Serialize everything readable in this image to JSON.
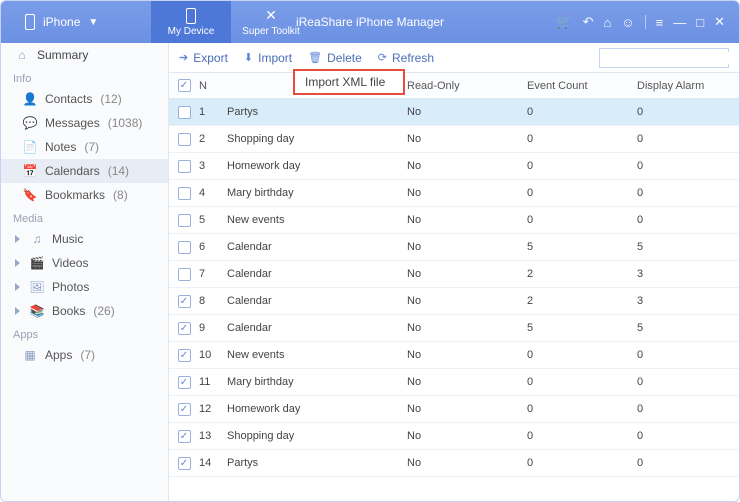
{
  "titlebar": {
    "device_label": "iPhone",
    "title": "iReaShare iPhone Manager"
  },
  "tabs": {
    "my_device": "My Device",
    "super_toolkit": "Super Toolkit"
  },
  "sidebar": {
    "summary": "Summary",
    "heads": {
      "info": "Info",
      "media": "Media",
      "apps": "Apps"
    },
    "info": [
      {
        "label": "Contacts",
        "count": "(12)"
      },
      {
        "label": "Messages",
        "count": "(1038)"
      },
      {
        "label": "Notes",
        "count": "(7)"
      },
      {
        "label": "Calendars",
        "count": "(14)"
      },
      {
        "label": "Bookmarks",
        "count": "(8)"
      }
    ],
    "media": [
      {
        "label": "Music",
        "count": ""
      },
      {
        "label": "Videos",
        "count": ""
      },
      {
        "label": "Photos",
        "count": ""
      },
      {
        "label": "Books",
        "count": "(26)"
      }
    ],
    "apps": [
      {
        "label": "Apps",
        "count": "(7)"
      }
    ]
  },
  "toolbar": {
    "export": "Export",
    "import": "Import",
    "delete": "Delete",
    "refresh": "Refresh",
    "dropdown_item": "Import XML file"
  },
  "columns": {
    "name": "N",
    "readonly": "Read-Only",
    "eventcount": "Event Count",
    "displayalarm": "Display Alarm"
  },
  "rows": [
    {
      "chk": false,
      "idx": "1",
      "name": "Partys",
      "ro": "No",
      "ec": "0",
      "da": "0",
      "sel": true
    },
    {
      "chk": false,
      "idx": "2",
      "name": "Shopping day",
      "ro": "No",
      "ec": "0",
      "da": "0"
    },
    {
      "chk": false,
      "idx": "3",
      "name": "Homework day",
      "ro": "No",
      "ec": "0",
      "da": "0"
    },
    {
      "chk": false,
      "idx": "4",
      "name": "Mary birthday",
      "ro": "No",
      "ec": "0",
      "da": "0"
    },
    {
      "chk": false,
      "idx": "5",
      "name": "New events",
      "ro": "No",
      "ec": "0",
      "da": "0"
    },
    {
      "chk": false,
      "idx": "6",
      "name": "Calendar",
      "ro": "No",
      "ec": "5",
      "da": "5"
    },
    {
      "chk": false,
      "idx": "7",
      "name": "Calendar",
      "ro": "No",
      "ec": "2",
      "da": "3"
    },
    {
      "chk": true,
      "idx": "8",
      "name": "Calendar",
      "ro": "No",
      "ec": "2",
      "da": "3"
    },
    {
      "chk": true,
      "idx": "9",
      "name": "Calendar",
      "ro": "No",
      "ec": "5",
      "da": "5"
    },
    {
      "chk": true,
      "idx": "10",
      "name": "New events",
      "ro": "No",
      "ec": "0",
      "da": "0"
    },
    {
      "chk": true,
      "idx": "11",
      "name": "Mary birthday",
      "ro": "No",
      "ec": "0",
      "da": "0"
    },
    {
      "chk": true,
      "idx": "12",
      "name": "Homework day",
      "ro": "No",
      "ec": "0",
      "da": "0"
    },
    {
      "chk": true,
      "idx": "13",
      "name": "Shopping day",
      "ro": "No",
      "ec": "0",
      "da": "0"
    },
    {
      "chk": true,
      "idx": "14",
      "name": "Partys",
      "ro": "No",
      "ec": "0",
      "da": "0"
    }
  ]
}
